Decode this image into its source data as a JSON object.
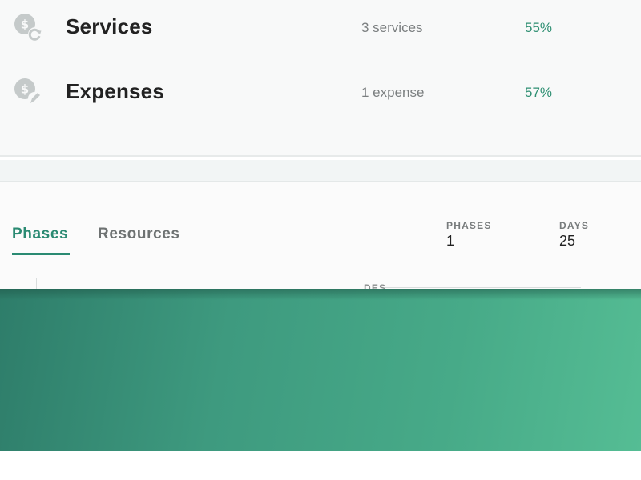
{
  "summary": {
    "rows": [
      {
        "icon": "dollar-refresh-icon",
        "label": "Services",
        "count": "3 services",
        "percent": "55%"
      },
      {
        "icon": "dollar-edit-icon",
        "label": "Expenses",
        "count": "1 expense",
        "percent": "57%"
      }
    ]
  },
  "tabs": [
    {
      "label": "Phases",
      "active": true
    },
    {
      "label": "Resources",
      "active": false
    }
  ],
  "stats": {
    "phases": {
      "label": "PHASES",
      "value": "1"
    },
    "days": {
      "label": "DAYS",
      "value": "25"
    }
  },
  "table_peek": {
    "header_fragment": "DES"
  },
  "colors": {
    "accent": "#2a8a72",
    "percent_green": "#2e8f72",
    "overlay_start": "#2e7d6a",
    "overlay_end": "#55bd94"
  }
}
